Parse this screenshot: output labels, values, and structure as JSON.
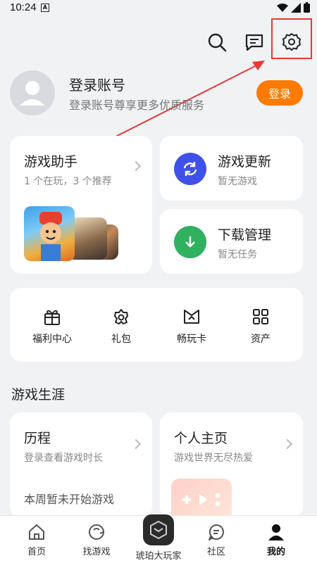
{
  "status_bar": {
    "time": "10:24"
  },
  "header": {
    "icons": [
      "search-icon",
      "message-icon",
      "settings-icon"
    ]
  },
  "profile": {
    "title": "登录账号",
    "subtitle": "登录账号尊享更多优质服务",
    "login_button": "登录"
  },
  "cards": {
    "game_assistant": {
      "title": "游戏助手",
      "desc": "1 个在玩，3 个推荐"
    },
    "game_update": {
      "title": "游戏更新",
      "desc": "暂无游戏"
    },
    "download_manager": {
      "title": "下载管理",
      "desc": "暂无任务"
    }
  },
  "quick_actions": [
    {
      "label": "福利中心",
      "icon": "gift-icon"
    },
    {
      "label": "礼包",
      "icon": "gift-pack-icon"
    },
    {
      "label": "畅玩卡",
      "icon": "play-card-icon"
    },
    {
      "label": "资产",
      "icon": "grid-icon"
    }
  ],
  "career": {
    "section_title": "游戏生涯",
    "history": {
      "title": "历程",
      "desc": "登录查看游戏时长",
      "note": "本周暂未开始游戏"
    },
    "homepage": {
      "title": "个人主页",
      "desc": "游戏世界无尽热爱"
    }
  },
  "bottom_nav": [
    {
      "label": "首页",
      "icon": "home-icon"
    },
    {
      "label": "找游戏",
      "icon": "find-game-icon"
    },
    {
      "label": "琥珀大玩家",
      "icon": "amber-player-icon"
    },
    {
      "label": "社区",
      "icon": "community-icon"
    },
    {
      "label": "我的",
      "icon": "profile-icon"
    }
  ],
  "colors": {
    "accent": "#ff7a00",
    "update_blue": "#3f51e8",
    "download_green": "#2fb15f",
    "annotation_red": "#e53935"
  }
}
